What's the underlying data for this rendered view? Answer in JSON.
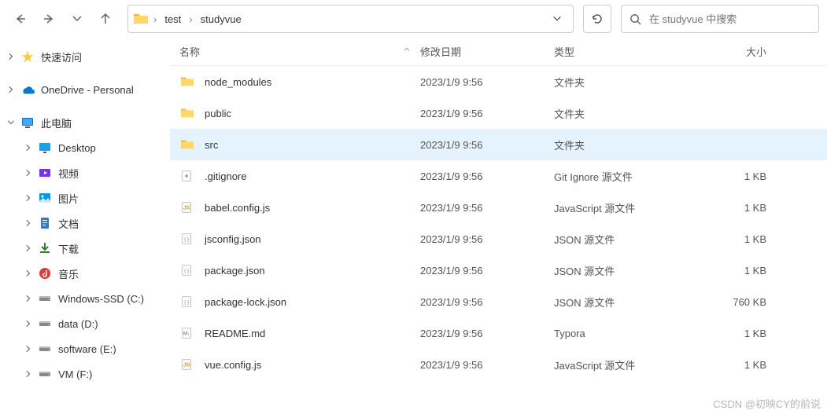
{
  "breadcrumb": {
    "folder1": "test",
    "folder2": "studyvue"
  },
  "search": {
    "placeholder": "在 studyvue 中搜索"
  },
  "sidebar": {
    "items": [
      {
        "label": "快速访问"
      },
      {
        "label": "OneDrive - Personal"
      },
      {
        "label": "此电脑"
      },
      {
        "label": "Desktop"
      },
      {
        "label": "视频"
      },
      {
        "label": "图片"
      },
      {
        "label": "文档"
      },
      {
        "label": "下载"
      },
      {
        "label": "音乐"
      },
      {
        "label": "Windows-SSD (C:)"
      },
      {
        "label": "data (D:)"
      },
      {
        "label": "software (E:)"
      },
      {
        "label": "VM (F:)"
      }
    ]
  },
  "columns": {
    "name": "名称",
    "date": "修改日期",
    "type": "类型",
    "size": "大小"
  },
  "files": [
    {
      "name": "node_modules",
      "date": "2023/1/9 9:56",
      "type": "文件夹",
      "size": "",
      "icon": "folder"
    },
    {
      "name": "public",
      "date": "2023/1/9 9:56",
      "type": "文件夹",
      "size": "",
      "icon": "folder"
    },
    {
      "name": "src",
      "date": "2023/1/9 9:56",
      "type": "文件夹",
      "size": "",
      "icon": "folder"
    },
    {
      "name": ".gitignore",
      "date": "2023/1/9 9:56",
      "type": "Git Ignore 源文件",
      "size": "1 KB",
      "icon": "git"
    },
    {
      "name": "babel.config.js",
      "date": "2023/1/9 9:56",
      "type": "JavaScript 源文件",
      "size": "1 KB",
      "icon": "js"
    },
    {
      "name": "jsconfig.json",
      "date": "2023/1/9 9:56",
      "type": "JSON 源文件",
      "size": "1 KB",
      "icon": "json"
    },
    {
      "name": "package.json",
      "date": "2023/1/9 9:56",
      "type": "JSON 源文件",
      "size": "1 KB",
      "icon": "json"
    },
    {
      "name": "package-lock.json",
      "date": "2023/1/9 9:56",
      "type": "JSON 源文件",
      "size": "760 KB",
      "icon": "json"
    },
    {
      "name": "README.md",
      "date": "2023/1/9 9:56",
      "type": "Typora",
      "size": "1 KB",
      "icon": "md"
    },
    {
      "name": "vue.config.js",
      "date": "2023/1/9 9:56",
      "type": "JavaScript 源文件",
      "size": "1 KB",
      "icon": "js"
    }
  ],
  "watermark": "CSDN @初映CY的前说"
}
